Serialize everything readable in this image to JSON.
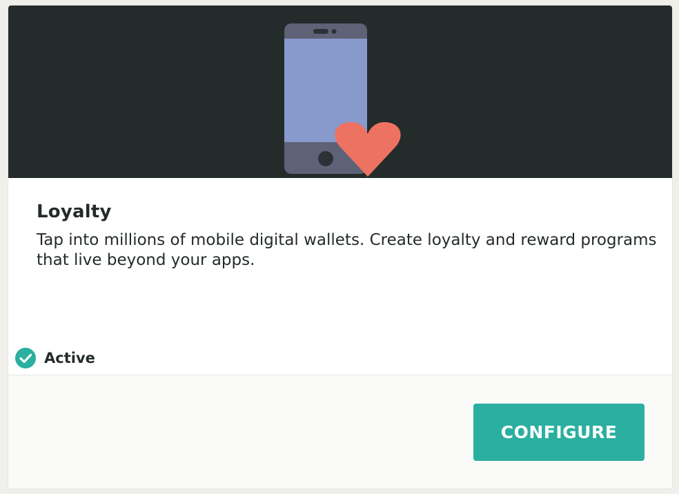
{
  "card": {
    "title": "Loyalty",
    "description": "Tap into millions of mobile digital wallets. Create loyalty and reward programs that live beyond your apps.",
    "status": {
      "label": "Active",
      "icon": "check-circle-icon",
      "color": "#2aafa0"
    },
    "configure_label": "CONFIGURE"
  },
  "hero": {
    "illustration": "phone-with-heart",
    "background": "#242b2b",
    "heart_color": "#ee7262",
    "phone_screen_color": "#8899cc",
    "phone_body_color": "#5d6277"
  }
}
